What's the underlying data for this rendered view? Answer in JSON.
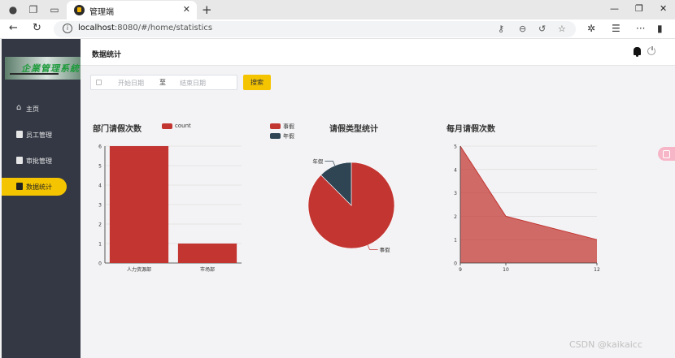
{
  "browser": {
    "tab_title": "管理端",
    "url_host": "localhost",
    "url_rest": ":8080/#/home/statistics"
  },
  "sidebar": {
    "logo_text": "企業管理系統",
    "items": [
      {
        "label": "主页",
        "icon": "home-icon"
      },
      {
        "label": "员工管理",
        "icon": "clipboard-icon"
      },
      {
        "label": "审批管理",
        "icon": "clipboard-icon"
      },
      {
        "label": "数据统计",
        "icon": "clipboard-icon",
        "active": true
      }
    ]
  },
  "header": {
    "title": "数据统计"
  },
  "filter": {
    "start_placeholder": "开始日期",
    "separator": "至",
    "end_placeholder": "结束日期",
    "search_label": "搜索"
  },
  "charts": {
    "accent": "#c23531",
    "secondary": "#2f4554"
  },
  "chart_data": [
    {
      "type": "bar",
      "title": "部门请假次数",
      "legend": [
        "count"
      ],
      "categories": [
        "人力资源部",
        "市场部"
      ],
      "values": [
        6,
        1
      ],
      "ylim": [
        0,
        6
      ],
      "yticks": [
        0,
        1,
        2,
        3,
        4,
        5,
        6
      ],
      "grid": true
    },
    {
      "type": "pie",
      "title": "请假类型统计",
      "legend": [
        "事假",
        "年假"
      ],
      "slices": [
        {
          "name": "事假",
          "value": 7
        },
        {
          "name": "年假",
          "value": 1
        }
      ]
    },
    {
      "type": "area",
      "title": "每月请假次数",
      "x": [
        9,
        10,
        12
      ],
      "y": [
        5,
        2,
        1
      ],
      "ylim": [
        0,
        5
      ],
      "yticks": [
        0,
        1,
        2,
        3,
        4,
        5
      ],
      "grid": true
    }
  ],
  "watermark": "CSDN @kaikaicc"
}
